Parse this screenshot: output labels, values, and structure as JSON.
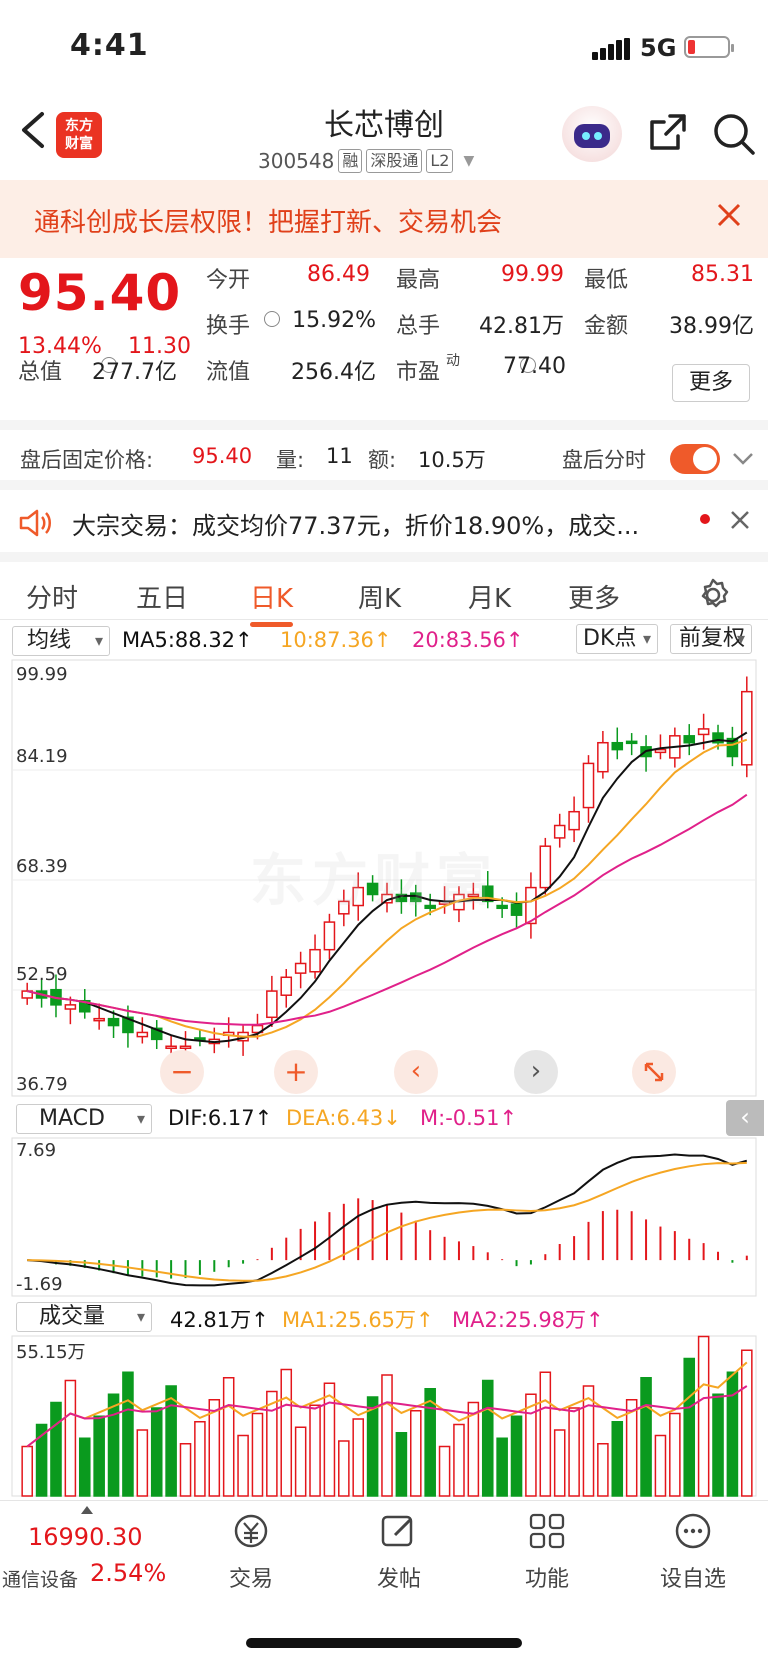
{
  "status": {
    "time": "4:41",
    "network": "5G"
  },
  "header": {
    "logo": "东方财富",
    "title": "长芯博创",
    "code": "300548",
    "tags": [
      "融",
      "深股通",
      "L2"
    ]
  },
  "banner": {
    "text": "通科创成长层权限！把握打新、交易机会"
  },
  "quote": {
    "price": "95.40",
    "change_pct": "13.44%",
    "change_amt": "11.30",
    "open_label": "今开",
    "open": "86.49",
    "high_label": "最高",
    "high": "99.99",
    "low_label": "最低",
    "low": "85.31",
    "turnover_label": "换手",
    "turnover": "15.92%",
    "volume_label": "总手",
    "volume": "42.81万",
    "amount_label": "金额",
    "amount": "38.99亿",
    "mktcap_label": "总值",
    "mktcap": "277.7亿",
    "float_label": "流值",
    "float": "256.4亿",
    "pe_label": "市盈",
    "pe_sup": "动",
    "pe": "77.40",
    "more": "更多"
  },
  "after_hours": {
    "label": "盘后固定价格:",
    "price": "95.40",
    "vol_label": "量:",
    "vol": "11",
    "amt_label": "额:",
    "amt": "10.5万",
    "timeshare": "盘后分时"
  },
  "notice": {
    "text": "大宗交易：成交均价77.37元，折价18.90%，成交..."
  },
  "tabs": [
    "分时",
    "五日",
    "日K",
    "周K",
    "月K",
    "更多"
  ],
  "active_tab": "日K",
  "kline_header": {
    "select": "均线",
    "ma5": "MA5:88.32↑",
    "ma10": "10:87.36↑",
    "ma20": "20:83.56↑",
    "dk": "DK点",
    "adjust": "前复权"
  },
  "price_axis": [
    "99.99",
    "84.19",
    "68.39",
    "52.59",
    "36.79"
  ],
  "macd_header": {
    "select": "MACD",
    "dif": "DIF:6.17↑",
    "dea": "DEA:6.43↓",
    "m": "M:-0.51↑"
  },
  "macd_axis": [
    "7.69",
    "-1.69"
  ],
  "vol_header": {
    "select": "成交量",
    "vol": "42.81万↑",
    "ma1": "MA1:25.65万↑",
    "ma2": "MA2:25.98万↑"
  },
  "vol_axis": [
    "55.15万"
  ],
  "watermark": "东方财富",
  "colors": {
    "up": "#e3161b",
    "down": "#0a9a1e",
    "accent": "#ef5a2a",
    "ma5": "#111111",
    "ma10": "#f5a623",
    "ma20": "#e0218a"
  },
  "bottom": {
    "index_value": "16990.30",
    "index_name": "通信设备",
    "index_pct": "2.54%",
    "items": [
      "交易",
      "发帖",
      "功能",
      "设自选"
    ]
  },
  "chart_data": {
    "type": "candlestick",
    "ylim": [
      36.79,
      99.99
    ],
    "close_approx": [
      52,
      51,
      50,
      50,
      49,
      48,
      47,
      46,
      46,
      45,
      44,
      44,
      45,
      45,
      46,
      46,
      47,
      52,
      54,
      56,
      58,
      62,
      65,
      67,
      66,
      66,
      65,
      65,
      64,
      65,
      66,
      66,
      65,
      64,
      63,
      67,
      73,
      76,
      78,
      85,
      88,
      87,
      88,
      86,
      87,
      89,
      88,
      90,
      88,
      86,
      95.4
    ]
  }
}
